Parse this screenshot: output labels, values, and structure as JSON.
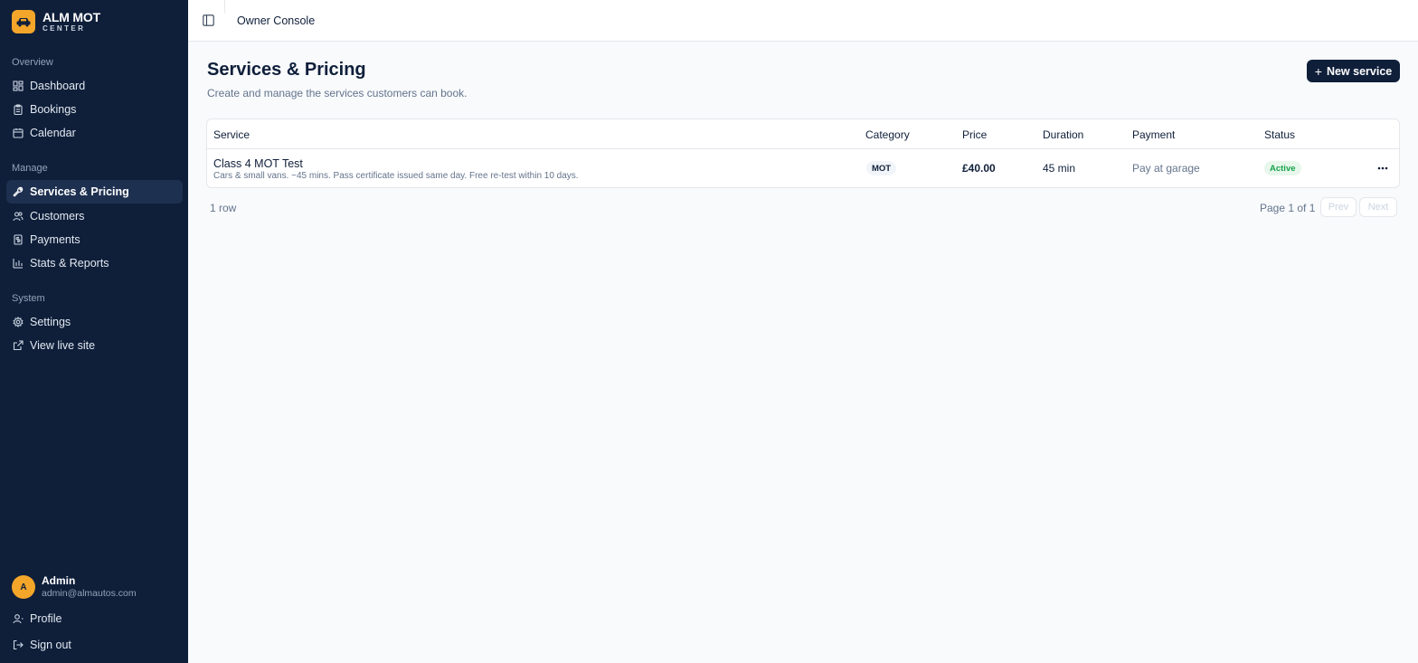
{
  "brand": {
    "name": "ALM MOT",
    "sub": "CENTER",
    "logo_icon": "car-icon",
    "accent": "#f4a62a"
  },
  "sidebar": {
    "sections": [
      {
        "label": "Overview",
        "items": [
          {
            "label": "Dashboard",
            "icon": "dashboard-icon"
          },
          {
            "label": "Bookings",
            "icon": "clipboard-icon"
          },
          {
            "label": "Calendar",
            "icon": "calendar-icon"
          }
        ]
      },
      {
        "label": "Manage",
        "items": [
          {
            "label": "Services & Pricing",
            "icon": "wrench-icon",
            "active": true
          },
          {
            "label": "Customers",
            "icon": "users-icon"
          },
          {
            "label": "Payments",
            "icon": "receipt-icon"
          },
          {
            "label": "Stats & Reports",
            "icon": "bar-chart-icon"
          }
        ]
      },
      {
        "label": "System",
        "items": [
          {
            "label": "Settings",
            "icon": "gear-icon"
          },
          {
            "label": "View live site",
            "icon": "external-link-icon"
          }
        ]
      }
    ],
    "user": {
      "initial": "A",
      "name": "Admin",
      "email": "admin@almautos.com"
    },
    "footer": [
      {
        "label": "Profile",
        "icon": "user-icon"
      },
      {
        "label": "Sign out",
        "icon": "sign-out-icon"
      }
    ],
    "background": "#0f1f3a"
  },
  "topbar": {
    "title": "Owner Console",
    "toggle_icon": "sidebar-toggle-icon"
  },
  "main": {
    "title": "Services & Pricing",
    "subtitle": "Create and manage the services customers can book.",
    "new_button": "New service",
    "table": {
      "columns": [
        "Service",
        "Category",
        "Price",
        "Duration",
        "Payment",
        "Status"
      ],
      "rows": [
        {
          "name": "Class 4 MOT Test",
          "description": "Cars & small vans. ~45 mins. Pass certificate issued same day. Free re-test within 10 days.",
          "category": "MOT",
          "price": "£40.00",
          "duration": "45 min",
          "payment": "Pay at garage",
          "status": "Active"
        }
      ]
    },
    "footer": {
      "row_count": "1 row",
      "page_info": "Page 1 of 1",
      "prev": "Prev",
      "next": "Next"
    }
  }
}
